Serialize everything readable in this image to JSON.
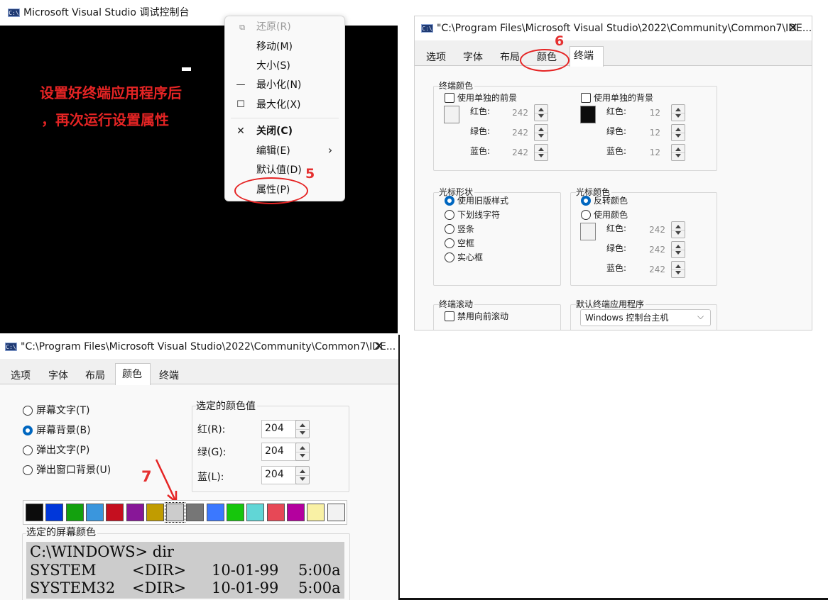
{
  "console": {
    "title": "Microsoft Visual Studio 调试控制台",
    "icon": "console-app-icon",
    "annotation_lines": [
      "设置好终端应用程序后",
      "，再次运行设置属性"
    ],
    "background": "#000000",
    "annotation_color": "#e52424"
  },
  "context_menu": {
    "items": [
      {
        "label": "还原(R)",
        "icon": "restore-icon",
        "glyph": "⧉",
        "disabled": true
      },
      {
        "label": "移动(M)",
        "icon": "",
        "glyph": "",
        "disabled": false
      },
      {
        "label": "大小(S)",
        "icon": "",
        "glyph": "",
        "disabled": false
      },
      {
        "label": "最小化(N)",
        "icon": "minimize-icon",
        "glyph": "—",
        "disabled": false
      },
      {
        "label": "最大化(X)",
        "icon": "maximize-icon",
        "glyph": "☐",
        "disabled": false
      },
      {
        "label": "关闭(C)",
        "icon": "close-icon",
        "glyph": "✕",
        "disabled": false,
        "bold": true
      },
      {
        "label": "编辑(E)",
        "icon": "chevron-right-icon",
        "glyph": "›",
        "disabled": false
      },
      {
        "label": "默认值(D)",
        "icon": "",
        "glyph": "",
        "disabled": false
      },
      {
        "label": "属性(P)",
        "icon": "",
        "glyph": "",
        "disabled": false
      }
    ],
    "step_number": "5"
  },
  "props_terminal": {
    "title": "\"C:\\Program Files\\Microsoft Visual Studio\\2022\\Community\\Common7\\IDE...",
    "close_glyph": "✕",
    "tabs": [
      "选项",
      "字体",
      "布局",
      "颜色",
      "终端"
    ],
    "selected_tab": "终端",
    "step_number": "6",
    "terminal_colors": {
      "group_label": "终端颜色",
      "fg_checkbox": "使用单独的前景",
      "bg_checkbox": "使用单独的背景",
      "fg": {
        "red_label": "红色:",
        "green_label": "绿色:",
        "blue_label": "蓝色:",
        "red": "242",
        "green": "242",
        "blue": "242",
        "swatch": "#f2f2f2"
      },
      "bg": {
        "red_label": "红色:",
        "green_label": "绿色:",
        "blue_label": "蓝色:",
        "red": "12",
        "green": "12",
        "blue": "12",
        "swatch": "#0c0c0c"
      }
    },
    "cursor_shape": {
      "group_label": "光标形状",
      "options": [
        "使用旧版样式",
        "下划线字符",
        "竖条",
        "空框",
        "实心框"
      ],
      "selected": 0
    },
    "cursor_color": {
      "group_label": "光标颜色",
      "options": [
        "反转颜色",
        "使用颜色"
      ],
      "selected": 0,
      "red_label": "红色:",
      "green_label": "绿色:",
      "blue_label": "蓝色:",
      "red": "242",
      "green": "242",
      "blue": "242"
    },
    "terminal_scroll": {
      "group_label": "终端滚动",
      "checkbox": "禁用向前滚动"
    },
    "default_terminal": {
      "group_label": "默认终端应用程序",
      "value": "Windows 控制台主机"
    }
  },
  "props_color": {
    "title": "\"C:\\Program Files\\Microsoft Visual Studio\\2022\\Community\\Common7\\IDE...",
    "close_glyph": "✕",
    "tabs": [
      "选项",
      "字体",
      "布局",
      "颜色",
      "终端"
    ],
    "selected_tab": "颜色",
    "targets": [
      "屏幕文字(T)",
      "屏幕背景(B)",
      "弹出文字(P)",
      "弹出窗口背景(U)"
    ],
    "selected_target": 1,
    "selected_values": {
      "group_label": "选定的颜色值",
      "red_label": "红(R):",
      "green_label": "绿(G):",
      "blue_label": "蓝(L):",
      "red": "204",
      "green": "204",
      "blue": "204"
    },
    "palette": [
      "#0c0c0c",
      "#0037da",
      "#13a10e",
      "#3a96dd",
      "#c50f1f",
      "#881798",
      "#c19c00",
      "#cccccc",
      "#767676",
      "#3b78ff",
      "#16c60c",
      "#61d6d6",
      "#e74856",
      "#b4009e",
      "#f9f1a5",
      "#f2f2f2"
    ],
    "selected_palette_index": 7,
    "step_number": "7",
    "preview": {
      "group_label": "选定的屏幕颜色",
      "line1": "C:\\WINDOWS> dir",
      "rows": [
        {
          "name": "SYSTEM",
          "dir": "<DIR>",
          "date": "10-01-99",
          "time": "5:00a"
        },
        {
          "name": "SYSTEM32",
          "dir": "<DIR>",
          "date": "10-01-99",
          "time": "5:00a"
        }
      ]
    }
  }
}
